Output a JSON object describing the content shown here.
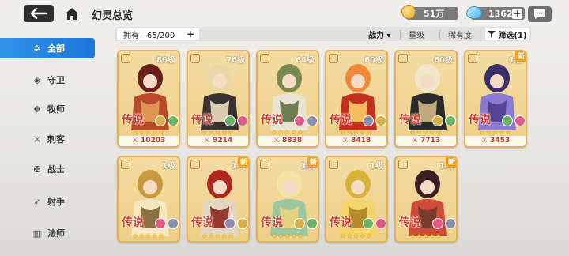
{
  "header": {
    "title": "幻灵总览",
    "gold": "51万",
    "gems": "13629",
    "plus_label": "+"
  },
  "sidebar": {
    "items": [
      {
        "label": "全部",
        "icon": "star-icon",
        "glyph": "✲"
      },
      {
        "label": "守卫",
        "icon": "shield-icon",
        "glyph": "◈"
      },
      {
        "label": "牧师",
        "icon": "wings-icon",
        "glyph": "✥"
      },
      {
        "label": "刺客",
        "icon": "dagger-icon",
        "glyph": "⚔"
      },
      {
        "label": "战士",
        "icon": "sword-icon",
        "glyph": "✠"
      },
      {
        "label": "射手",
        "icon": "bow-icon",
        "glyph": "➶"
      },
      {
        "label": "法师",
        "icon": "book-icon",
        "glyph": "▥"
      }
    ]
  },
  "filters": {
    "owned": "拥有：65/200",
    "power": "战力 ▾",
    "star": "星级",
    "rarity": "稀有度",
    "filter": "筛选(1)"
  },
  "cards": [
    {
      "level": "80级",
      "rank": "传说",
      "power": "⚔ 10203",
      "new": "",
      "colors": [
        "#6b1f1a",
        "#b84a2b",
        "#e6a15a"
      ]
    },
    {
      "level": "76级",
      "rank": "传说",
      "power": "⚔ 9214",
      "new": "",
      "colors": [
        "#e9d7a8",
        "#3a3232",
        "#f3e9c7"
      ]
    },
    {
      "level": "64级",
      "rank": "传说",
      "power": "⚔ 8838",
      "new": "",
      "colors": [
        "#7a8a4e",
        "#e7e4d2",
        "#5b6b3d"
      ]
    },
    {
      "level": "60级",
      "rank": "传说",
      "power": "⚔ 8418",
      "new": "",
      "colors": [
        "#f08a3a",
        "#c3321f",
        "#ffd26b"
      ]
    },
    {
      "level": "60级",
      "rank": "传说",
      "power": "⚔ 7713",
      "new": "",
      "colors": [
        "#f3e6c8",
        "#2a2a2a",
        "#d8c08e"
      ]
    },
    {
      "level": "1级",
      "rank": "传说",
      "power": "⚔ 3453",
      "new": "新",
      "colors": [
        "#3a2f6a",
        "#8a7ad1",
        "#4a3b8a"
      ]
    },
    {
      "level": "1级",
      "rank": "传说",
      "power": "",
      "new": "",
      "colors": [
        "#c89a3f",
        "#f5e7c0",
        "#7a5a2a"
      ]
    },
    {
      "level": "1级",
      "rank": "传说",
      "power": "",
      "new": "新",
      "colors": [
        "#b0261f",
        "#e2d6c0",
        "#8a1d1a"
      ]
    },
    {
      "level": "1级",
      "rank": "传说",
      "power": "",
      "new": "新",
      "colors": [
        "#f6e2a6",
        "#9ac6a0",
        "#f3d27a"
      ]
    },
    {
      "level": "1级",
      "rank": "传说",
      "power": "",
      "new": "",
      "colors": [
        "#d9b23a",
        "#f3d56a",
        "#a8801e"
      ]
    },
    {
      "level": "1级",
      "rank": "传说",
      "power": "",
      "new": "新",
      "colors": [
        "#3a1f22",
        "#d04a3a",
        "#6a3a2a"
      ]
    }
  ],
  "stars": "★★★★★",
  "elements": [
    "#d7b04a",
    "#68b26a",
    "#e25a85",
    "#8d8db0"
  ]
}
